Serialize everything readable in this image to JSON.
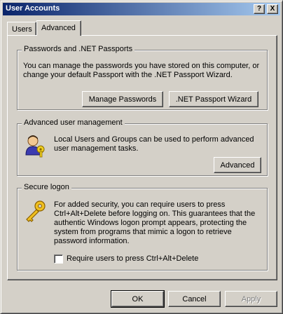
{
  "window": {
    "title": "User Accounts",
    "help_label": "?",
    "close_label": "X"
  },
  "tabs": [
    {
      "label": "Users",
      "selected": false
    },
    {
      "label": "Advanced",
      "selected": true
    }
  ],
  "passports": {
    "title": "Passwords and .NET Passports",
    "text": "You can manage the passwords you have stored on this computer, or change your default Passport with the .NET Passport Wizard.",
    "manage_button": "Manage Passwords",
    "wizard_button": ".NET Passport Wizard"
  },
  "advanced_mgmt": {
    "title": "Advanced user management",
    "text": "Local Users and Groups can be used to perform advanced user management tasks.",
    "button": "Advanced"
  },
  "secure_logon": {
    "title": "Secure logon",
    "text": "For added security, you can require users to press Ctrl+Alt+Delete before logging on. This guarantees that the authentic Windows logon prompt appears, protecting the system from programs that mimic a logon to retrieve password information.",
    "checkbox_label": "Require users to press Ctrl+Alt+Delete",
    "checkbox_checked": false
  },
  "footer": {
    "ok": "OK",
    "cancel": "Cancel",
    "apply": "Apply"
  },
  "icons": {
    "users": "users-icon",
    "key": "key-icon"
  },
  "colors": {
    "face": "#d4d0c8",
    "title_start": "#0a246a",
    "title_end": "#a6caf0"
  }
}
